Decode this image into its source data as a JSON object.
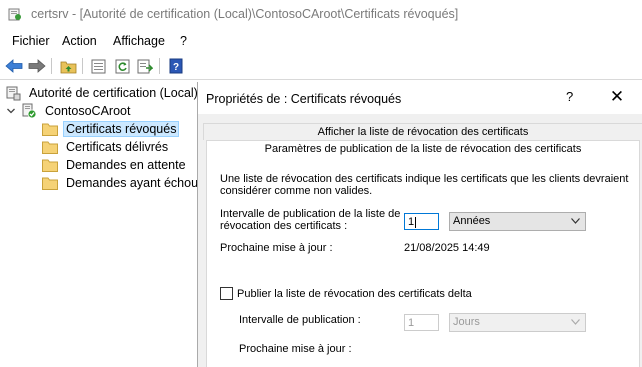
{
  "window": {
    "title": "certsrv - [Autorité de certification (Local)\\ContosoCAroot\\Certificats révoqués]",
    "icon": "certsrv-app-icon"
  },
  "menu": [
    "Fichier",
    "Action",
    "Affichage",
    "?"
  ],
  "toolbar": {
    "buttons": [
      "back-arrow-icon",
      "forward-arrow-icon",
      "up-folder-icon",
      "show-hide-tree-icon",
      "refresh-icon",
      "export-list-icon",
      "help-book-icon"
    ]
  },
  "tree": {
    "root": "Autorité de certification (Local)",
    "ca": "ContosoCAroot",
    "items": [
      {
        "label": "Certificats révoqués",
        "selected": true
      },
      {
        "label": "Certificats délivrés"
      },
      {
        "label": "Demandes en attente"
      },
      {
        "label": "Demandes ayant échoué"
      }
    ]
  },
  "dialog": {
    "title": "Propriétés de : Certificats révoqués",
    "help": "?",
    "close": "✕",
    "tabs": [
      "Afficher la liste de révocation des certificats",
      "Paramètres de publication de la liste de révocation des certificats"
    ],
    "description": "Une liste de révocation des certificats indique les certificats que les clients devraient considérer comme non valides.",
    "crl": {
      "interval_label": "Intervalle de publication de la liste de révocation des certificats :",
      "interval_value": "1",
      "unit": "Années",
      "next_update_label": "Prochaine mise à jour :",
      "next_update_value": "21/08/2025 14:49"
    },
    "delta": {
      "checkbox_label": "Publier la liste de révocation des certificats delta",
      "checked": false,
      "interval_label": "Intervalle de publication :",
      "interval_value": "1",
      "unit": "Jours",
      "next_update_label": "Prochaine mise à jour :"
    }
  },
  "colors": {
    "selection": "#cce8ff",
    "focus_border": "#0078d7",
    "dialog_bg": "#f0f0f0"
  }
}
